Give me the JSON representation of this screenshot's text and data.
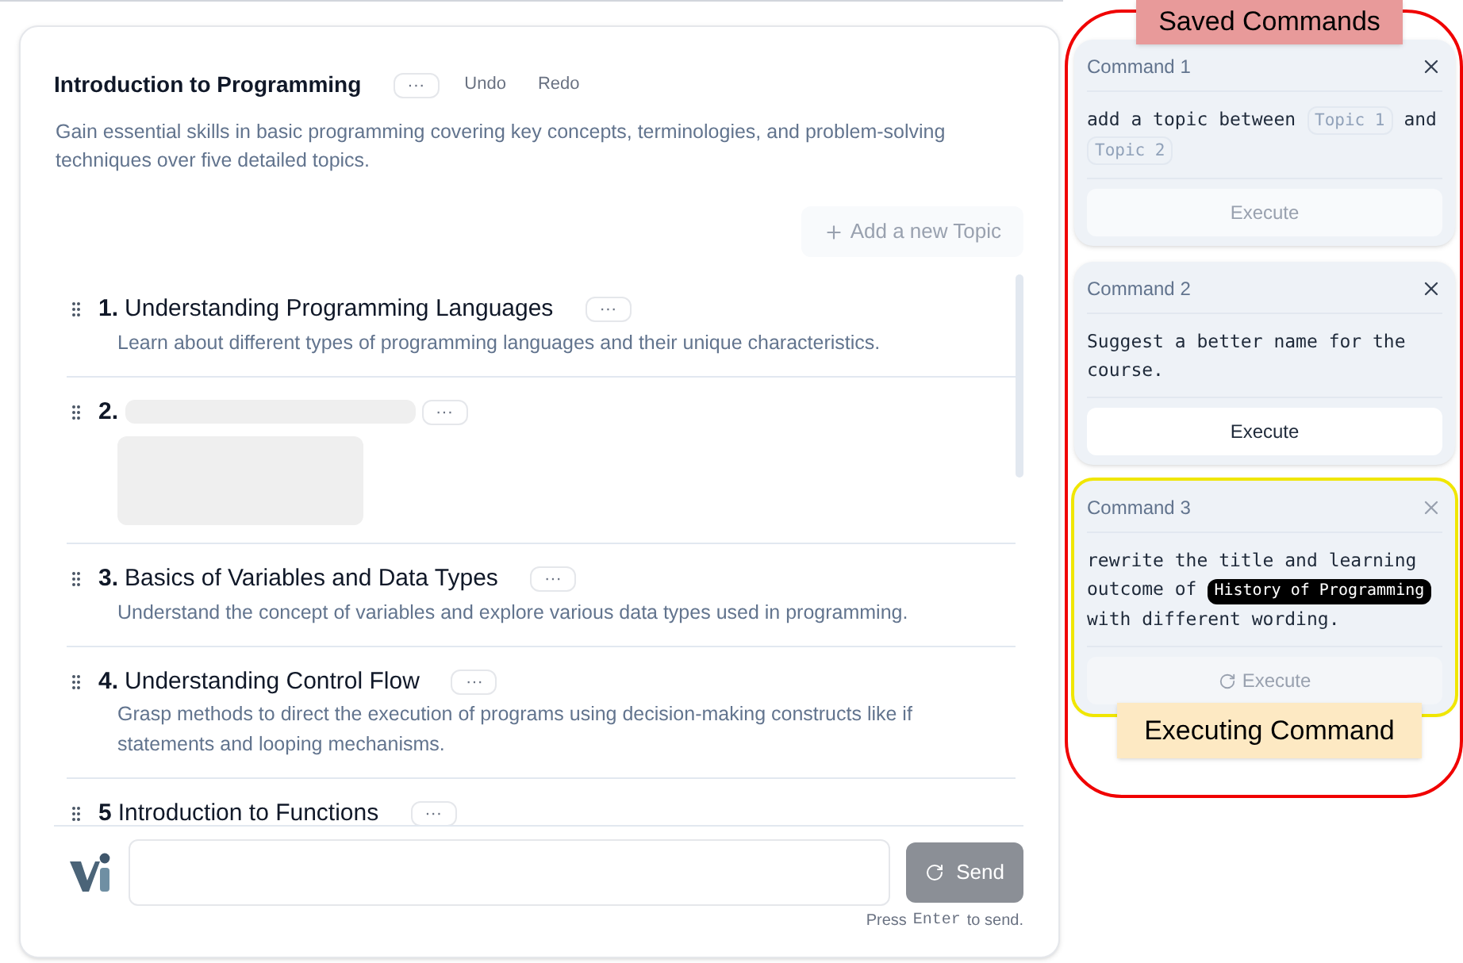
{
  "course": {
    "title": "Introduction to Programming",
    "menu": "···",
    "undo": "Undo",
    "redo": "Redo",
    "description": "Gain essential skills in basic programming covering key concepts, terminologies, and problem-solving techniques over five detailed topics."
  },
  "add_topic": "Add a new Topic",
  "topics": [
    {
      "number": "1.",
      "title": "Understanding Programming Languages",
      "description": "Learn about different types of programming languages and their unique characteristics.",
      "loading": false,
      "menu": "···"
    },
    {
      "number": "2.",
      "loading": true,
      "menu": "···"
    },
    {
      "number": "3.",
      "title": "Basics of Variables and Data Types",
      "description": "Understand the concept of variables and explore various data types used in programming.",
      "loading": false,
      "menu": "···"
    },
    {
      "number": "4.",
      "title": "Understanding Control Flow",
      "description": "Grasp methods to direct the execution of programs using decision-making constructs like if statements and looping mechanisms.",
      "loading": false,
      "menu": "···"
    },
    {
      "number": "5",
      "title": "Introduction to Functions",
      "loading": false,
      "menu": "···"
    }
  ],
  "chat": {
    "send": "Send",
    "sending": true,
    "hint_before": "Press",
    "hint_key": "Enter",
    "hint_after": "to send."
  },
  "saved_commands": [
    {
      "title": "Command 1",
      "disabled": true,
      "executing": false,
      "execute": "Execute",
      "segments": [
        {
          "kind": "text",
          "text": "add a topic between"
        },
        {
          "kind": "tag",
          "text": "Topic 1"
        },
        {
          "kind": "text",
          "text": "and"
        },
        {
          "kind": "tag",
          "text": "Topic 2"
        }
      ]
    },
    {
      "title": "Command 2",
      "disabled": false,
      "executing": false,
      "execute": "Execute",
      "segments": [
        {
          "kind": "text",
          "text": "Suggest a better name for the"
        },
        {
          "kind": "text",
          "text": "course."
        }
      ]
    },
    {
      "title": "Command 3",
      "disabled": true,
      "executing": true,
      "execute": "Execute",
      "segments": [
        {
          "kind": "text",
          "text": "rewrite the title and learning"
        },
        {
          "kind": "text",
          "text": "outcome of"
        },
        {
          "kind": "highlight",
          "text": "History of Programming"
        },
        {
          "kind": "text",
          "text": "with different wording."
        }
      ]
    }
  ],
  "annotations": {
    "saved_label": "Saved Commands",
    "executing_label": "Executing Command"
  }
}
